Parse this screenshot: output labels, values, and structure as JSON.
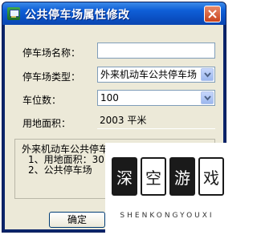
{
  "window": {
    "title": "公共停车场属性修改"
  },
  "form": {
    "name_label": "停车场名称：",
    "name_value": "",
    "type_label": "停车场类型：",
    "type_value": "外来机动车公共停车场",
    "spaces_label": "车位数：",
    "spaces_value": "100",
    "area_label": "用地面积：",
    "area_value": "2003 平米"
  },
  "standard": {
    "heading": "外来机动车公共停车场规划标准：",
    "line1": "1、用地面积：30",
    "line2": "2、公共停车场"
  },
  "buttons": {
    "ok": "确定"
  },
  "watermark": {
    "chars": [
      "深",
      "空",
      "游",
      "戏"
    ],
    "text": "SHENKONGYOUXI"
  }
}
